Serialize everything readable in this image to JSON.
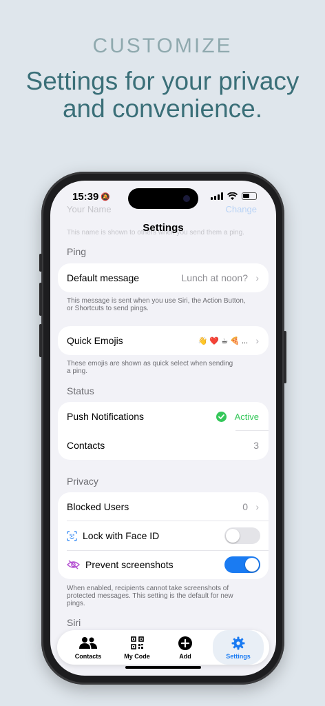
{
  "hero": {
    "kicker": "CUSTOMIZE",
    "title_line1": "Settings for your privacy",
    "title_line2": "and convenience."
  },
  "status_bar": {
    "time": "15:39"
  },
  "background_ghost": {
    "name_label": "Your Name",
    "change_label": "Change",
    "name_note": "This name is shown to others when you send them a ping."
  },
  "nav": {
    "title": "Settings"
  },
  "ping": {
    "header": "Ping",
    "default_message_label": "Default message",
    "default_message_value": "Lunch at noon?",
    "default_message_note_1": "This message is sent when you use Siri, the Action Button,",
    "default_message_note_2": "or Shortcuts to send pings.",
    "quick_emojis_label": "Quick Emojis",
    "quick_emojis_value": "👋 ❤️ ☕ 🍕 ...",
    "quick_emojis_note_1": "These emojis are shown as quick select when sending",
    "quick_emojis_note_2": "a ping."
  },
  "status": {
    "header": "Status",
    "push_label": "Push Notifications",
    "push_value": "Active",
    "contacts_label": "Contacts",
    "contacts_value": "3"
  },
  "privacy": {
    "header": "Privacy",
    "blocked_label": "Blocked Users",
    "blocked_value": "0",
    "face_id_label": "Lock with Face ID",
    "face_id_on": false,
    "screenshots_label": "Prevent screenshots",
    "screenshots_on": true,
    "note_1": "When enabled, recipients cannot take screenshots of",
    "note_2": "protected messages. This setting is the default for new",
    "note_3": "pings."
  },
  "siri": {
    "header": "Siri"
  },
  "tabbar": {
    "tabs": [
      {
        "label": "Contacts",
        "icon": "people-icon"
      },
      {
        "label": "My Code",
        "icon": "qr-code-icon"
      },
      {
        "label": "Add",
        "icon": "plus-circle-icon"
      },
      {
        "label": "Settings",
        "icon": "gear-icon",
        "active": true
      }
    ]
  },
  "colors": {
    "accent": "#1a7bf2",
    "active_green": "#34c759",
    "hero_title": "#3a6f78",
    "hero_kicker": "#8fa9ae",
    "eye_slash_purple": "#b44fd1"
  }
}
